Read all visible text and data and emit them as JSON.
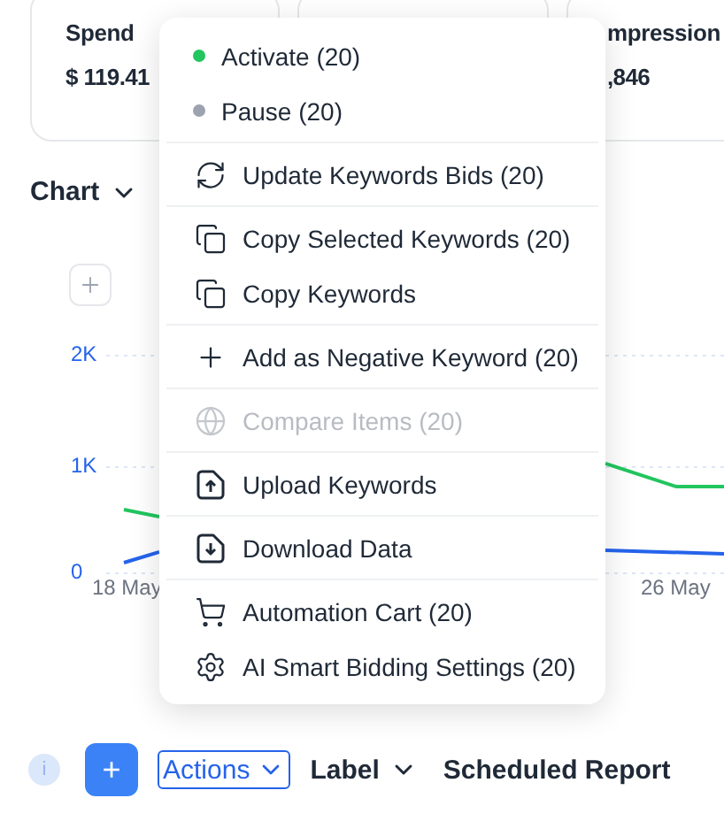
{
  "stats": [
    {
      "label": "Spend",
      "value": "$ 119.41"
    },
    {
      "label": "mpression",
      "value": ",846"
    }
  ],
  "chart": {
    "title": "Chart",
    "y_labels": [
      "2K",
      "1K",
      "0"
    ],
    "x_labels": [
      "18 May",
      "26 May"
    ]
  },
  "menu": {
    "sections": [
      {
        "items": [
          {
            "kind": "status",
            "label": "Activate (20)",
            "color": "#22c55e",
            "disabled": false
          },
          {
            "kind": "status",
            "label": "Pause (20)",
            "color": "#9ca3af",
            "disabled": false
          }
        ]
      },
      {
        "items": [
          {
            "kind": "refresh",
            "label": "Update Keywords Bids (20)",
            "disabled": false
          }
        ]
      },
      {
        "items": [
          {
            "kind": "copy",
            "label": "Copy Selected Keywords (20)",
            "disabled": false
          },
          {
            "kind": "copy",
            "label": "Copy Keywords",
            "disabled": false
          }
        ]
      },
      {
        "items": [
          {
            "kind": "plus",
            "label": "Add as Negative Keyword (20)",
            "disabled": false
          }
        ]
      },
      {
        "items": [
          {
            "kind": "globe",
            "label": "Compare Items (20)",
            "disabled": true
          }
        ]
      },
      {
        "items": [
          {
            "kind": "upload",
            "label": "Upload Keywords",
            "disabled": false
          }
        ]
      },
      {
        "items": [
          {
            "kind": "download",
            "label": "Download Data",
            "disabled": false
          }
        ]
      },
      {
        "items": [
          {
            "kind": "cart",
            "label": "Automation Cart (20)",
            "disabled": false
          },
          {
            "kind": "gear",
            "label": "AI Smart Bidding Settings (20)",
            "disabled": false
          }
        ]
      }
    ]
  },
  "toolbar": {
    "info": "i",
    "add": "+",
    "actions": {
      "label": "Actions",
      "open": true
    },
    "label": "Label",
    "report": "Scheduled Report"
  }
}
